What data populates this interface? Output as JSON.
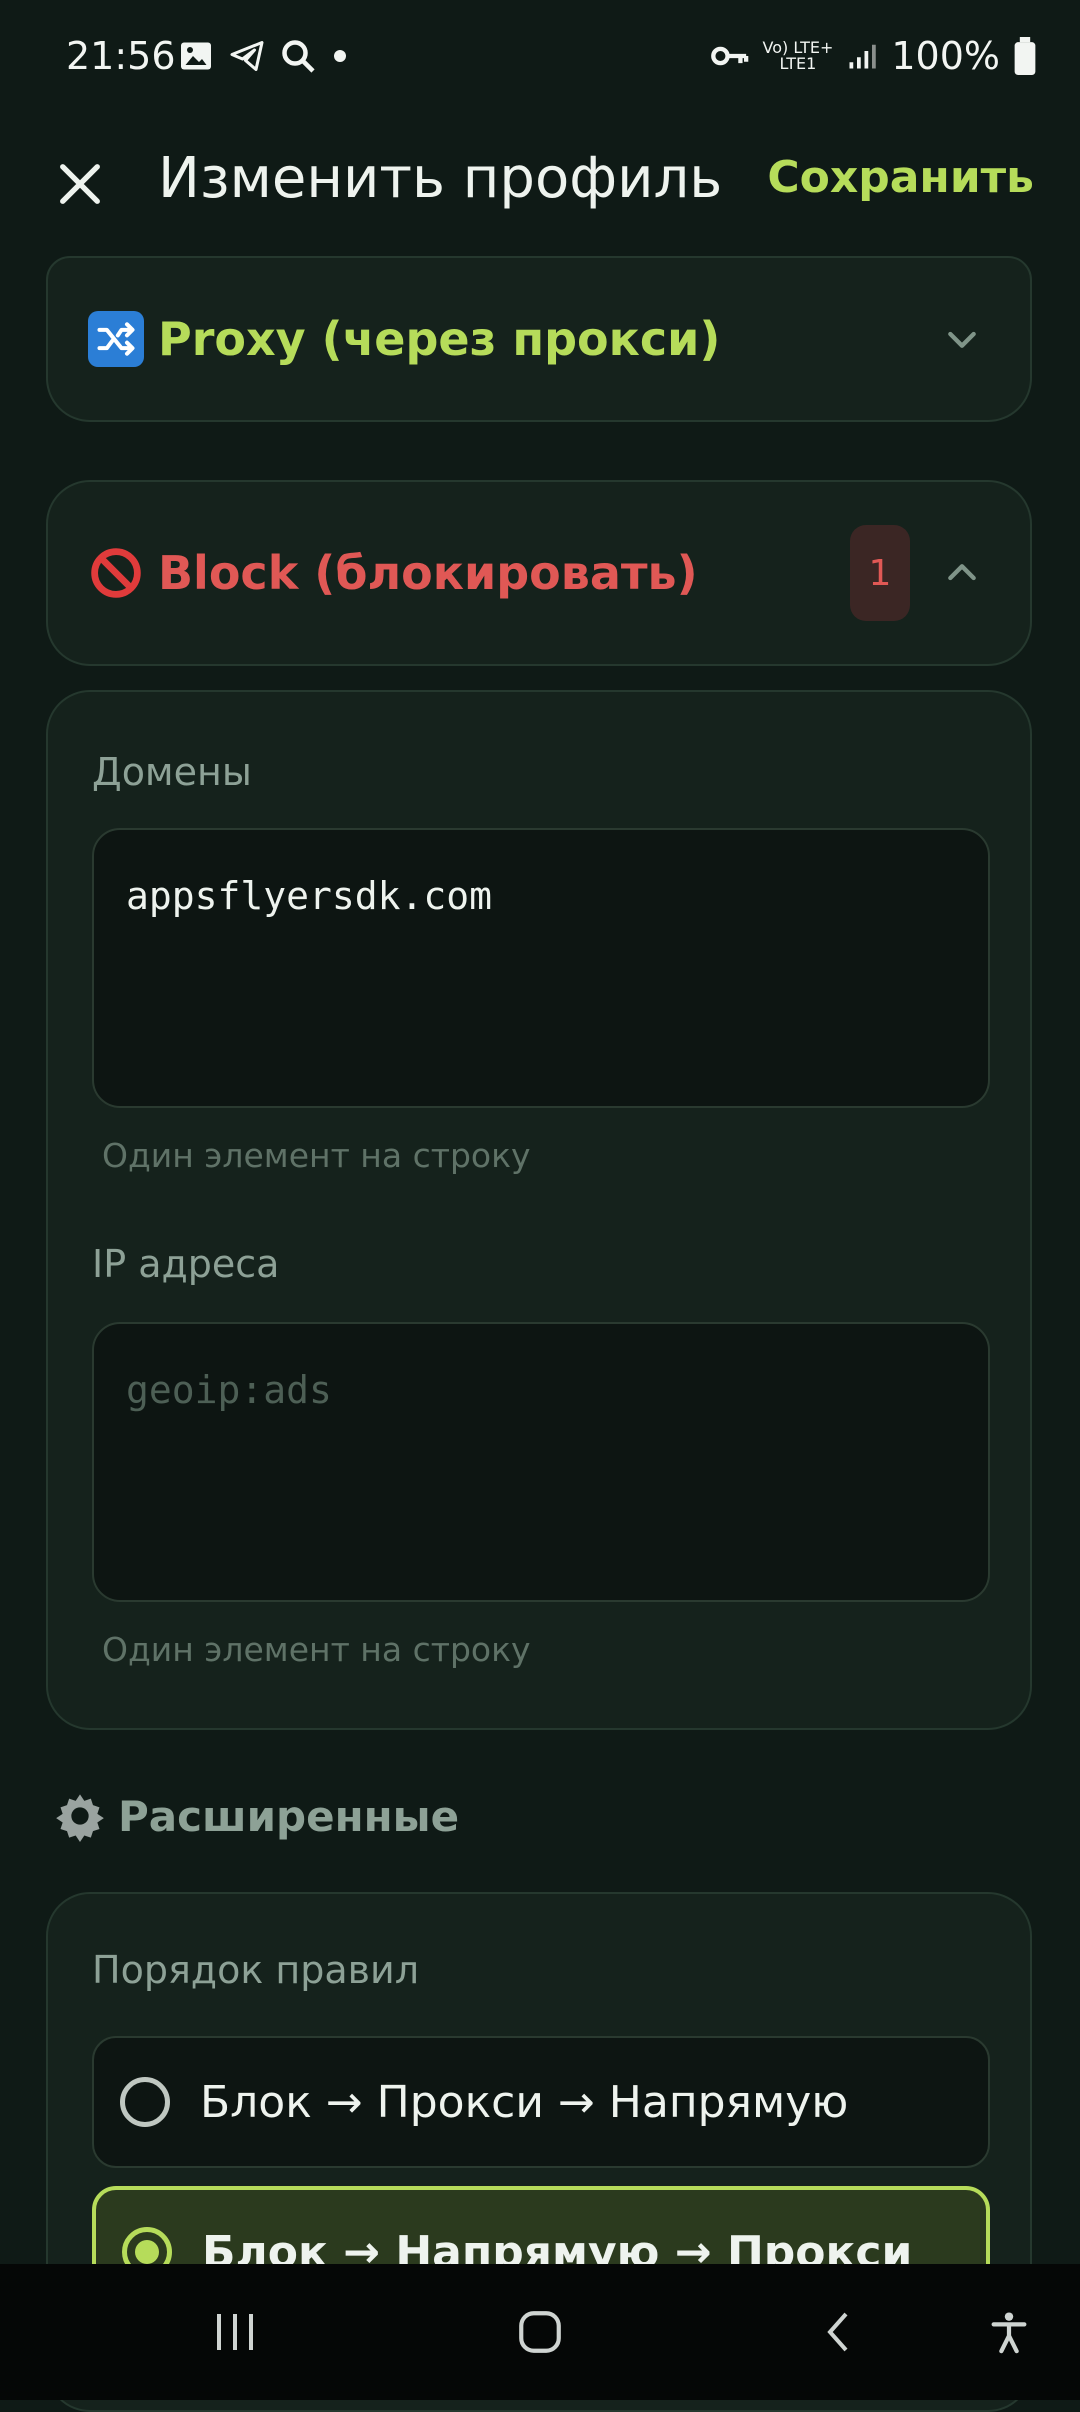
{
  "status_bar": {
    "time": "21:56",
    "battery": "100%",
    "network_top": "Vo) LTE+",
    "network_bottom": "LTE1",
    "icons": [
      "image-icon",
      "telegram-icon",
      "search-icon",
      "dot-icon",
      "key-icon",
      "signal-icon",
      "battery-icon"
    ]
  },
  "appbar": {
    "title": "Изменить профиль",
    "save_label": "Сохранить"
  },
  "proxy_section": {
    "title": "Proxy (через прокси)",
    "color": "#b6dc5a",
    "icon": "shuffle-icon"
  },
  "block_section": {
    "title": "Block (блокировать)",
    "color": "#e05855",
    "icon": "prohibited-icon",
    "badge": "1",
    "domains_label": "Домены",
    "domains_value": "appsflyersdk.com",
    "domains_hint": "Один элемент на строку",
    "ip_label": "IP адреса",
    "ip_placeholder": "geoip:ads",
    "ip_hint": "Один элемент на строку"
  },
  "advanced": {
    "title": "Расширенные",
    "icon": "gear-icon",
    "rule_order_label": "Порядок правил",
    "options": [
      {
        "label": "Блок → Прокси → Напрямую",
        "selected": false
      },
      {
        "label": "Блок → Напрямую → Прокси",
        "selected": true
      }
    ]
  },
  "navbar": {
    "icons": [
      "recent-apps-icon",
      "home-icon",
      "back-icon",
      "accessibility-icon"
    ]
  }
}
